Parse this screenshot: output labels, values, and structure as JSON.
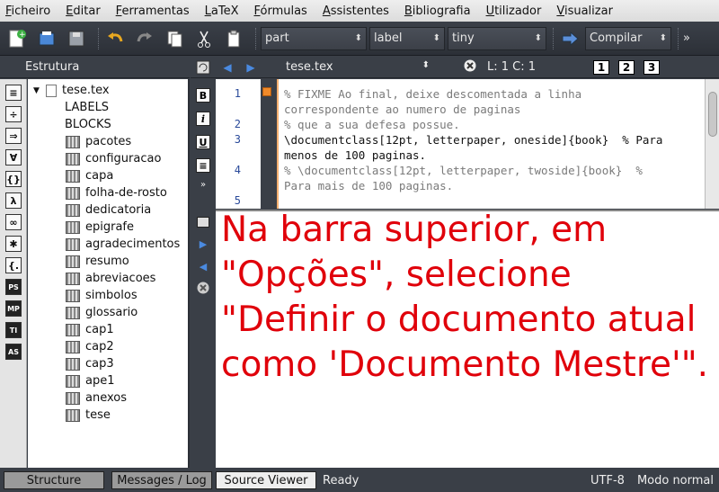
{
  "menu": [
    "Ficheiro",
    "Editar",
    "Ferramentas",
    "LaTeX",
    "Fórmulas",
    "Assistentes",
    "Bibliografia",
    "Utilizador",
    "Visualizar"
  ],
  "toolbar": {
    "combo_part": "part",
    "combo_label": "label",
    "combo_size": "tiny",
    "compile_label": "Compilar",
    "more": "»"
  },
  "structure": {
    "title": "Estrutura",
    "root": "tese.tex",
    "labels": "LABELS",
    "blocks": "BLOCKS",
    "items": [
      "pacotes",
      "configuracao",
      "capa",
      "folha-de-rosto",
      "dedicatoria",
      "epigrafe",
      "agradecimentos",
      "resumo",
      "abreviacoes",
      "simbolos",
      "glossario",
      "cap1",
      "cap2",
      "cap3",
      "ape1",
      "anexos",
      "tese"
    ]
  },
  "sidebar_icons": [
    "≡",
    "÷",
    "⇒",
    "∀",
    "{}",
    "λ",
    "∞",
    "✱",
    "{.",
    "PS",
    "MP",
    "TI",
    "AS"
  ],
  "editor": {
    "filename": "tese.tex",
    "cursor": "L: 1 C: 1",
    "view_1": "1",
    "view_2": "2",
    "view_3": "3",
    "line_numbers": [
      "1",
      "2",
      "3",
      "4",
      "5"
    ],
    "code_lines": [
      "% FIXME Ao final, deixe descomentada a linha",
      "correspondente ao numero de paginas",
      "% que a sua defesa possue.",
      "\\documentclass[12pt, letterpaper, oneside]{book}  % Para",
      "menos de 100 paginas.",
      "% \\documentclass[12pt, letterpaper, twoside]{book}  %",
      "Para mais de 100 paginas."
    ]
  },
  "instruction": "Na barra superior, em \"Opções\", selecione \"Definir o documento atual como 'Documento Mestre'\".",
  "status": {
    "tab_structure": "Structure",
    "tab_messages": "Messages / Log",
    "tab_source": "Source Viewer",
    "state": "Ready",
    "encoding": "UTF-8",
    "mode": "Modo normal"
  },
  "colors": {
    "accent": "#e0000a",
    "panel": "#3a3f47"
  }
}
